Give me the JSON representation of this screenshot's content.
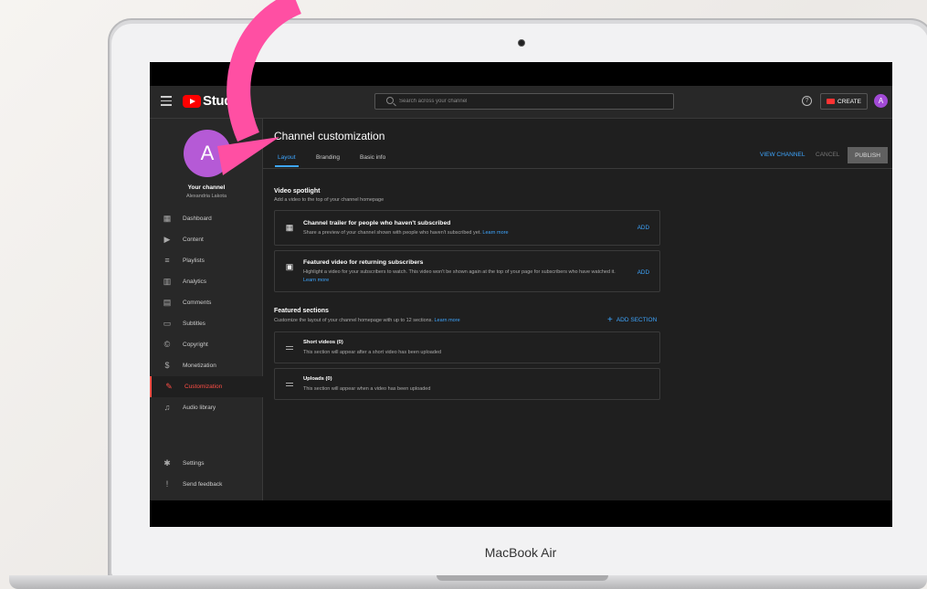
{
  "laptop": {
    "brand_label": "MacBook Air"
  },
  "topbar": {
    "app_name": "Stud",
    "search_placeholder": "Search across your channel",
    "help_glyph": "?",
    "create_label": "CREATE",
    "account_initial": "A"
  },
  "sidebar": {
    "avatar_initial": "A",
    "channel_title": "Your channel",
    "channel_name": "Alexandria Lakota",
    "items": [
      {
        "label": "Dashboard",
        "icon": "dashboard-icon"
      },
      {
        "label": "Content",
        "icon": "content-icon"
      },
      {
        "label": "Playlists",
        "icon": "playlists-icon"
      },
      {
        "label": "Analytics",
        "icon": "analytics-icon"
      },
      {
        "label": "Comments",
        "icon": "comments-icon"
      },
      {
        "label": "Subtitles",
        "icon": "subtitles-icon"
      },
      {
        "label": "Copyright",
        "icon": "copyright-icon"
      },
      {
        "label": "Monetization",
        "icon": "monetization-icon"
      },
      {
        "label": "Customization",
        "icon": "customization-icon",
        "active": true
      },
      {
        "label": "Audio library",
        "icon": "audio-library-icon"
      }
    ],
    "bottom_items": [
      {
        "label": "Settings",
        "icon": "settings-icon"
      },
      {
        "label": "Send feedback",
        "icon": "feedback-icon"
      }
    ]
  },
  "main": {
    "title": "Channel customization",
    "tabs": [
      {
        "label": "Layout",
        "active": true
      },
      {
        "label": "Branding"
      },
      {
        "label": "Basic info"
      }
    ],
    "actions": {
      "view_channel": "VIEW CHANNEL",
      "cancel": "CANCEL",
      "publish": "PUBLISH"
    },
    "video_spotlight": {
      "title": "Video spotlight",
      "description": "Add a video to the top of your channel homepage",
      "cards": [
        {
          "title": "Channel trailer for people who haven't subscribed",
          "description": "Share a preview of your channel shown with people who haven't subscribed yet.",
          "link": "Learn more",
          "action": "ADD"
        },
        {
          "title": "Featured video for returning subscribers",
          "description": "Highlight a video for your subscribers to watch. This video won't be shown again at the top of your page for subscribers who have watched it.",
          "link": "Learn more",
          "action": "ADD"
        }
      ]
    },
    "featured_sections": {
      "title": "Featured sections",
      "description": "Customize the layout of your channel homepage with up to 12 sections.",
      "link": "Learn more",
      "add_label": "ADD SECTION",
      "sections": [
        {
          "title": "Short videos (0)",
          "description": "This section will appear after a short video has been uploaded"
        },
        {
          "title": "Uploads (0)",
          "description": "This section will appear when a video has been uploaded"
        }
      ]
    }
  },
  "colors": {
    "accent_blue": "#3ea6ff",
    "active_red": "#ff4e45",
    "arrow_pink": "#ff4fa3",
    "avatar_purple": "#b55ad6"
  }
}
